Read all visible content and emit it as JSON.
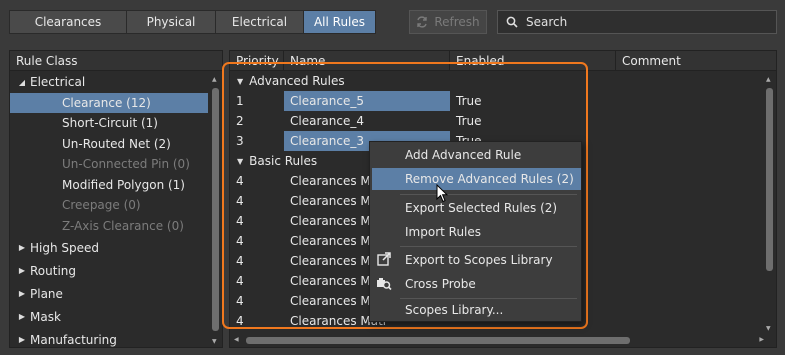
{
  "tabs": [
    {
      "label": "Clearances",
      "active": false
    },
    {
      "label": "Physical",
      "active": false
    },
    {
      "label": "Electrical",
      "active": false
    },
    {
      "label": "All Rules",
      "active": true
    }
  ],
  "toolbar": {
    "refresh_label": "Refresh",
    "search_placeholder": "Search"
  },
  "rule_class": {
    "header": "Rule Class",
    "electrical": {
      "label": "Electrical",
      "children": [
        {
          "label": "Clearance (12)",
          "selected": true,
          "disabled": false
        },
        {
          "label": "Short-Circuit (1)",
          "selected": false,
          "disabled": false
        },
        {
          "label": "Un-Routed Net (2)",
          "selected": false,
          "disabled": false
        },
        {
          "label": "Un-Connected Pin (0)",
          "selected": false,
          "disabled": true
        },
        {
          "label": "Modified Polygon (1)",
          "selected": false,
          "disabled": false
        },
        {
          "label": "Creepage (0)",
          "selected": false,
          "disabled": true
        },
        {
          "label": "Z-Axis Clearance (0)",
          "selected": false,
          "disabled": true
        }
      ]
    },
    "groups": [
      "High Speed",
      "Routing",
      "Plane",
      "Mask",
      "Manufacturing"
    ]
  },
  "grid": {
    "columns": [
      "Priority",
      "Name",
      "Enabled",
      "Comment"
    ],
    "advanced_section": "Advanced Rules",
    "basic_section": "Basic Rules",
    "advanced_rows": [
      {
        "priority": "1",
        "name": "Clearance_5",
        "enabled": "True"
      },
      {
        "priority": "2",
        "name": "Clearance_4",
        "enabled": "True"
      },
      {
        "priority": "3",
        "name": "Clearance_3",
        "enabled": "True"
      }
    ],
    "basic_rows": [
      {
        "priority": "4",
        "name": "Clearances Mat"
      },
      {
        "priority": "4",
        "name": "Clearances Mat"
      },
      {
        "priority": "4",
        "name": "Clearances Mat"
      },
      {
        "priority": "4",
        "name": "Clearances Mat"
      },
      {
        "priority": "4",
        "name": "Clearances Mat"
      },
      {
        "priority": "4",
        "name": "Clearances Mat"
      },
      {
        "priority": "4",
        "name": "Clearances Mat"
      },
      {
        "priority": "4",
        "name": "Clearances Matr"
      }
    ]
  },
  "context_menu": {
    "items": [
      {
        "label": "Add Advanced Rule",
        "icon": ""
      },
      {
        "label": "Remove Advanced Rules (2)",
        "icon": "",
        "hover": true
      },
      {
        "label": "Export Selected Rules (2)",
        "icon": ""
      },
      {
        "label": "Import Rules",
        "icon": ""
      },
      {
        "label": "Export to Scopes Library",
        "icon": "export-icon"
      },
      {
        "label": "Cross Probe",
        "icon": "cross-probe-icon"
      },
      {
        "label": "Scopes Library...",
        "icon": ""
      }
    ]
  },
  "colors": {
    "accent": "#5c7fa6",
    "highlight_border": "#f0781e",
    "background": "#3a3a3a",
    "panel": "#2b2b2b"
  }
}
